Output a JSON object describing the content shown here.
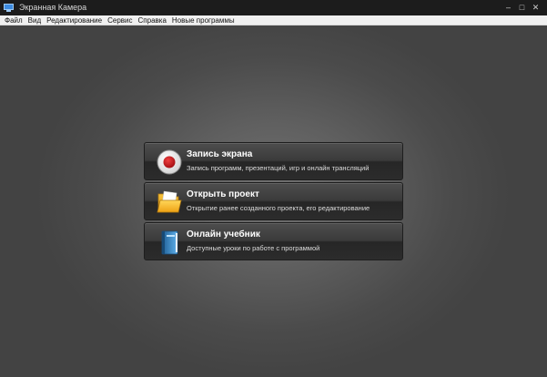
{
  "window": {
    "title": "Экранная Камера",
    "minimize_glyph": "–",
    "maximize_glyph": "□",
    "close_glyph": "✕"
  },
  "menu": {
    "items": [
      {
        "label": "Файл"
      },
      {
        "label": "Вид"
      },
      {
        "label": "Редактирование"
      },
      {
        "label": "Сервис"
      },
      {
        "label": "Справка"
      },
      {
        "label": "Новые программы"
      }
    ]
  },
  "actions": [
    {
      "title": "Запись экрана",
      "description": "Запись программ, презентаций, игр и онлайн трансляций",
      "icon": "record-icon"
    },
    {
      "title": "Открыть проект",
      "description": "Открытие ранее созданного проекта, его редактирование",
      "icon": "folder-icon"
    },
    {
      "title": "Онлайн учебник",
      "description": "Доступные уроки по работе с программой",
      "icon": "book-icon"
    }
  ],
  "colors": {
    "titlebar": "#1c1c1c",
    "workspace": "#454545",
    "record_red": "#c0161a",
    "folder_yellow": "#f3b21c",
    "book_blue": "#3b8fd0"
  }
}
